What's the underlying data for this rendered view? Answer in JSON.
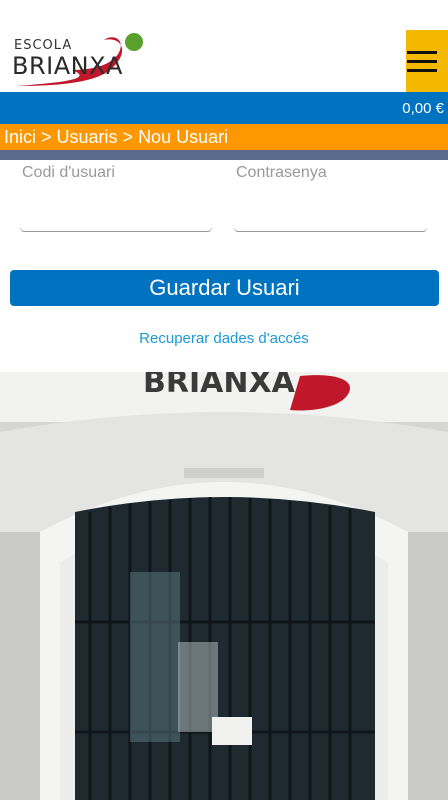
{
  "header": {
    "logo_small": "ESCOLA",
    "logo_big": "BRIANXA"
  },
  "cart": {
    "amount": "0,00 €"
  },
  "breadcrumb": {
    "items": [
      "Inici",
      "Usuaris",
      "Nou Usuari"
    ],
    "separator": " > "
  },
  "form": {
    "user_code_label": "Codi d'usuari",
    "password_label": "Contrasenya",
    "user_code_value": "",
    "password_value": "",
    "save_label": "Guardar Usuari",
    "recover_label": "Recuperar dades d'accés"
  },
  "photo": {
    "sign_text": "BRIANXA"
  },
  "colors": {
    "blue": "#0073c0",
    "orange": "#ff9800",
    "yellow": "#f5b800",
    "link": "#1a9ad6",
    "logo_red": "#c0182a",
    "logo_green": "#5aa02c"
  }
}
